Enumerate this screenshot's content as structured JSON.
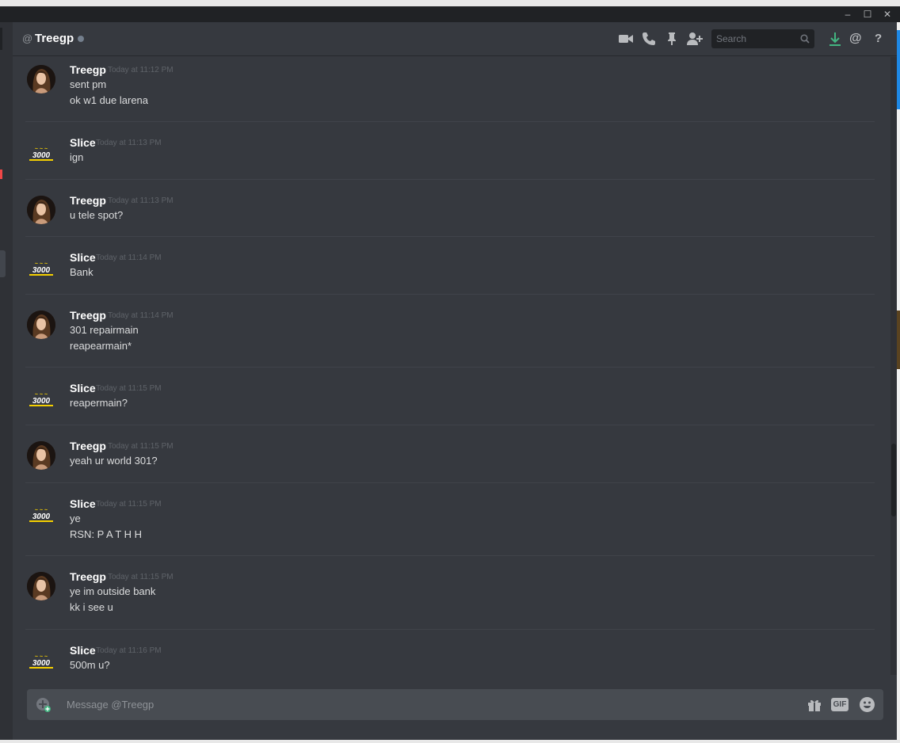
{
  "window": {
    "minimize_glyph": "–",
    "maximize_glyph": "☐",
    "close_glyph": "✕"
  },
  "header": {
    "at_symbol": "@",
    "channel_name": "Treegp",
    "status_color": "#747f8d",
    "icons": [
      "video-call-icon",
      "voice-call-icon",
      "pin-icon",
      "add-friend-icon",
      "download-icon",
      "mention-icon",
      "help-icon"
    ],
    "search_placeholder": "Search"
  },
  "messages": [
    {
      "author": "Treegp",
      "avatar": "treegp-avatar",
      "timestamp": "Today at 11:12 PM",
      "lines": [
        "sent pm",
        "ok w1 due larena"
      ]
    },
    {
      "author": "Slice",
      "avatar": "slice-avatar",
      "timestamp": "Today at 11:13 PM",
      "lines": [
        "ign"
      ]
    },
    {
      "author": "Treegp",
      "avatar": "treegp-avatar",
      "timestamp": "Today at 11:13 PM",
      "lines": [
        "u tele spot?"
      ]
    },
    {
      "author": "Slice",
      "avatar": "slice-avatar",
      "timestamp": "Today at 11:14 PM",
      "lines": [
        "Bank"
      ]
    },
    {
      "author": "Treegp",
      "avatar": "treegp-avatar",
      "timestamp": "Today at 11:14 PM",
      "lines": [
        "301 repairmain",
        "reapearmain*"
      ]
    },
    {
      "author": "Slice",
      "avatar": "slice-avatar",
      "timestamp": "Today at 11:15 PM",
      "lines": [
        "reapermain?"
      ]
    },
    {
      "author": "Treegp",
      "avatar": "treegp-avatar",
      "timestamp": "Today at 11:15 PM",
      "lines": [
        "yeah ur world 301?"
      ]
    },
    {
      "author": "Slice",
      "avatar": "slice-avatar",
      "timestamp": "Today at 11:15 PM",
      "lines": [
        "ye",
        "RSN: P A T H H"
      ]
    },
    {
      "author": "Treegp",
      "avatar": "treegp-avatar",
      "timestamp": "Today at 11:15 PM",
      "lines": [
        "ye im outside bank",
        "kk i see u"
      ]
    },
    {
      "author": "Slice",
      "avatar": "slice-avatar",
      "timestamp": "Today at 11:16 PM",
      "lines": [
        "500m u?"
      ]
    }
  ],
  "composer": {
    "placeholder": "Message @Treegp",
    "icons": [
      "upload-plus-icon",
      "gift-icon",
      "gif-icon",
      "emoji-icon"
    ],
    "gif_label": "GIF"
  }
}
